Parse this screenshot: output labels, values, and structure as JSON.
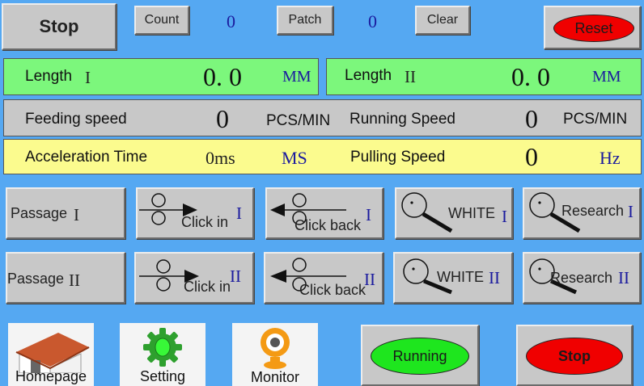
{
  "top": {
    "stop_label": "Stop",
    "count_label": "Count",
    "count_value": "0",
    "patch_label": "Patch",
    "patch_value": "0",
    "clear_label": "Clear",
    "reset_label": "Reset"
  },
  "length1": {
    "label": "Length",
    "roman": "I",
    "value": "0. 0",
    "unit": "MM"
  },
  "length2": {
    "label": "Length",
    "roman": "II",
    "value": "0. 0",
    "unit": "MM"
  },
  "feeding": {
    "label": "Feeding speed",
    "value": "0",
    "unit": "PCS/MIN"
  },
  "running_speed": {
    "label": "Running Speed",
    "value": "0",
    "unit": "PCS/MIN"
  },
  "accel": {
    "label": "Acceleration Time",
    "value": "0ms",
    "unit": "MS"
  },
  "pulling": {
    "label": "Pulling Speed",
    "value": "0",
    "unit": "Hz"
  },
  "row1": {
    "passage": "Passage",
    "passage_roman": "I",
    "click_in": "Click in",
    "click_in_roman": "I",
    "click_back": "Click back",
    "click_back_roman": "I",
    "white": "WHITE",
    "white_roman": "I",
    "research": "Research",
    "research_roman": "I"
  },
  "row2": {
    "passage": "Passage",
    "passage_roman": "II",
    "click_in": "Click in",
    "click_in_roman": "II",
    "click_back": "Click back",
    "click_back_roman": "II",
    "white": "WHITE",
    "white_roman": "II",
    "research": "Research",
    "research_roman": "II"
  },
  "nav": {
    "homepage": "Homepage",
    "setting": "Setting",
    "monitor": "Monitor",
    "running": "Running",
    "stop": "Stop"
  },
  "colors": {
    "background": "#55a8f2",
    "green_panel": "#7cf77c",
    "yellow_panel": "#fbfb8e",
    "reset_red": "#f00000",
    "running_green": "#1ee61e"
  },
  "icons": {
    "homepage": "house-icon",
    "setting": "gear-icon",
    "monitor": "webcam-icon"
  }
}
